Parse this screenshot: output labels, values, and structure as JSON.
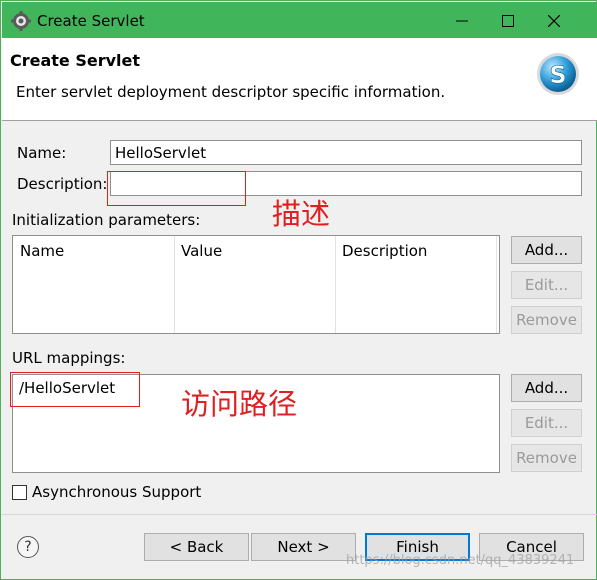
{
  "window": {
    "title": "Create Servlet",
    "accent_color": "#41b55a"
  },
  "header": {
    "title": "Create Servlet",
    "description": "Enter servlet deployment descriptor specific information.",
    "logo_letter": "S"
  },
  "form": {
    "name_label": "Name:",
    "name_value": "HelloServlet",
    "description_label": "Description:",
    "description_value": ""
  },
  "init_params": {
    "label": "Initialization parameters:",
    "columns": [
      "Name",
      "Value",
      "Description"
    ],
    "rows": [],
    "buttons": {
      "add": "Add...",
      "edit": "Edit...",
      "remove": "Remove"
    }
  },
  "url_mappings": {
    "label": "URL mappings:",
    "items": [
      "/HelloServlet"
    ],
    "buttons": {
      "add": "Add...",
      "edit": "Edit...",
      "remove": "Remove"
    }
  },
  "async": {
    "label": "Asynchronous Support",
    "checked": false
  },
  "footer": {
    "help": "?",
    "back": "< Back",
    "next": "Next >",
    "finish": "Finish",
    "cancel": "Cancel"
  },
  "annotations": {
    "description_note": "描述",
    "url_note": "访问路径",
    "annotation_color": "#e02020"
  },
  "watermark": "https://blog.csdn.net/qq_43839241"
}
